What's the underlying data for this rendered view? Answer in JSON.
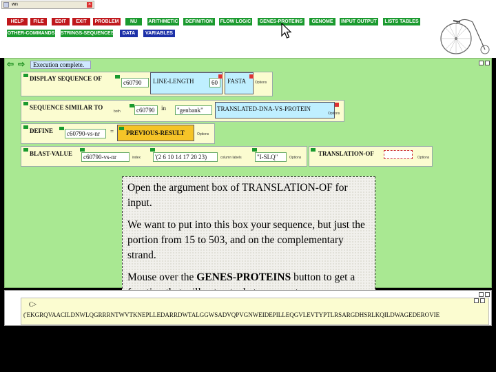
{
  "window": {
    "tab_title": "wn"
  },
  "toolbar": {
    "buttons": [
      {
        "label": "HELP",
        "color": "red"
      },
      {
        "label": "FILE",
        "color": "red"
      },
      {
        "label": "EDIT",
        "color": "red"
      },
      {
        "label": "EXIT",
        "color": "red"
      },
      {
        "label": "PROBLEM",
        "color": "red"
      },
      {
        "label": "NU",
        "color": "green"
      },
      {
        "label": "ARITHMETIC",
        "color": "green"
      },
      {
        "label": "DEFINITION",
        "color": "green"
      },
      {
        "label": "FLOW LOGIC",
        "color": "green"
      },
      {
        "label": "GENES-PROTEINS",
        "color": "green"
      },
      {
        "label": "GENOME",
        "color": "green"
      },
      {
        "label": "INPUT OUTPUT",
        "color": "green"
      },
      {
        "label": "LISTS TABLES",
        "color": "green"
      },
      {
        "label": "OTHER-COMMANDS",
        "color": "green"
      },
      {
        "label": "STRINGS-SEQUENCES",
        "color": "green"
      },
      {
        "label": "DATA",
        "color": "blue"
      },
      {
        "label": "VARIABLES",
        "color": "blue"
      }
    ]
  },
  "status": {
    "text": "Execution complete."
  },
  "commands": {
    "display": {
      "keyword": "DISPLAY SEQUENCE OF",
      "arg": "c60790",
      "line_length": "LINE-LENGTH",
      "line_val": "60",
      "fasta": "FASTA",
      "options": "Options"
    },
    "similar": {
      "keyword": "SEQUENCE SIMILAR TO",
      "both": "both",
      "arg": "c60790",
      "in": "in",
      "db": "\"genbank\"",
      "method": "TRANSLATED-DNA-VS-PROTEIN",
      "options": "Options"
    },
    "define": {
      "keyword": "DEFINE",
      "arg": "c60790-vs-nr",
      "eq": "=",
      "value": "PREVIOUS-RESULT",
      "options": "Options"
    },
    "blast": {
      "keyword": "BLAST-VALUE",
      "arg": "c60790-vs-nr",
      "index": "index",
      "list": "'(2 6 10 14 17 20 23)",
      "column": "column labels",
      "labels": "\"I-SLQ\"",
      "options": "Options",
      "translation": "TRANSLATION-OF",
      "options2": "Options"
    }
  },
  "tooltip": {
    "p1": "Open the argument box of TRANSLATION-OF for input.",
    "p2": "We want to put into this box your sequence, but just the portion from 15 to 503, and on the complementary strand.",
    "p3_pre": "Mouse over the ",
    "p3_bold": "GENES-PROTEINS",
    "p3_post": " button to get a function that will extract what you want."
  },
  "lower": {
    "label": "C>",
    "sequence": "('EKGRQVAACILDNWLQGRRRNTWVTKNEPLLEDARRDWTALGGWSADVQPVGNWEIDEPILLEQGVLEVTYPTLRSARGDHSRLKQILDWAGEDEROVIE"
  }
}
